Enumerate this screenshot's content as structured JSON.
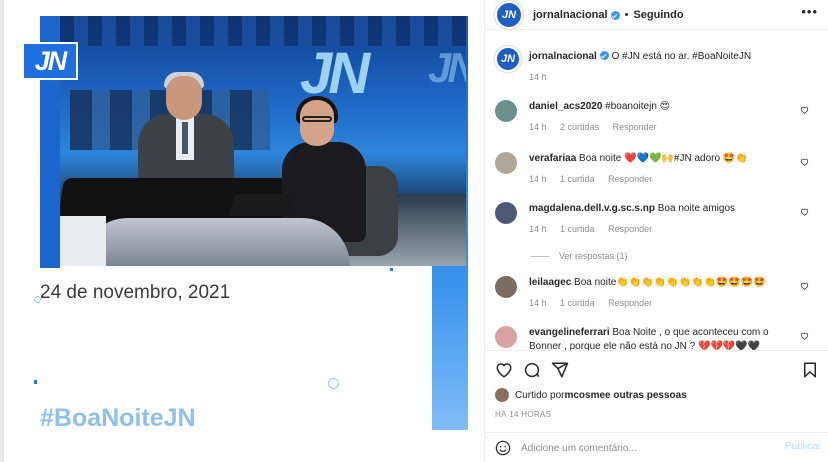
{
  "post": {
    "logo": "JN",
    "studio_text": "JN",
    "date": "24 de novembro, 2021",
    "hashtag": "#BoaNoiteJN"
  },
  "header": {
    "avatar_text": "JN",
    "username": "jornalnacional",
    "separator": "•",
    "follow_label": "Seguindo",
    "more_icon": "•••"
  },
  "caption": {
    "username": "jornalnacional",
    "text": " O #JN está no ar. #BoaNoiteJN",
    "time": "14 h"
  },
  "comments": [
    {
      "username": "daniel_acs2020",
      "text": " #boanoitejn 😍",
      "time": "14 h",
      "likes": "2 curtidas",
      "reply": "Responder",
      "avatar_color": "#6b8f8a"
    },
    {
      "username": "verafariaa",
      "text": " Boa noite ❤️💙💚🙌#JN adoro 🤩👏",
      "time": "14 h",
      "likes": "1 curtida",
      "reply": "Responder",
      "avatar_color": "#b0a79b"
    },
    {
      "username": "magdalena.dell.v.g.sc.s.np",
      "text": " Boa noite amigos",
      "time": "14 h",
      "likes": "1 curtida",
      "reply": "Responder",
      "avatar_color": "#4d5a73",
      "view_replies": "Ver respostas (1)"
    },
    {
      "username": "leilaagec",
      "text": " Boa noite👏👏👏👏👏👏👏👏🤩🤩🤩🤩",
      "time": "14 h",
      "likes": "1 curtida",
      "reply": "Responder",
      "avatar_color": "#7c6b61"
    },
    {
      "username": "evangelineferrari",
      "text": " Boa Noite , o que aconteceu com o Bonner , porque ele não está no JN ? 💔💔💔🖤🖤",
      "time": "",
      "likes": "",
      "reply": "",
      "avatar_color": "#d9a3a6"
    }
  ],
  "actions": {
    "like_icon": "heart-icon",
    "comment_icon": "comment-icon",
    "share_icon": "share-icon",
    "save_icon": "bookmark-icon"
  },
  "liked_by": {
    "prefix": "Curtido por ",
    "user": "mcosme",
    "suffix": " e outras pessoas"
  },
  "timestamp": "HÁ 14 HORAS",
  "add_comment": {
    "placeholder": "Adicione um comentário...",
    "publish_label": "Publicar"
  }
}
